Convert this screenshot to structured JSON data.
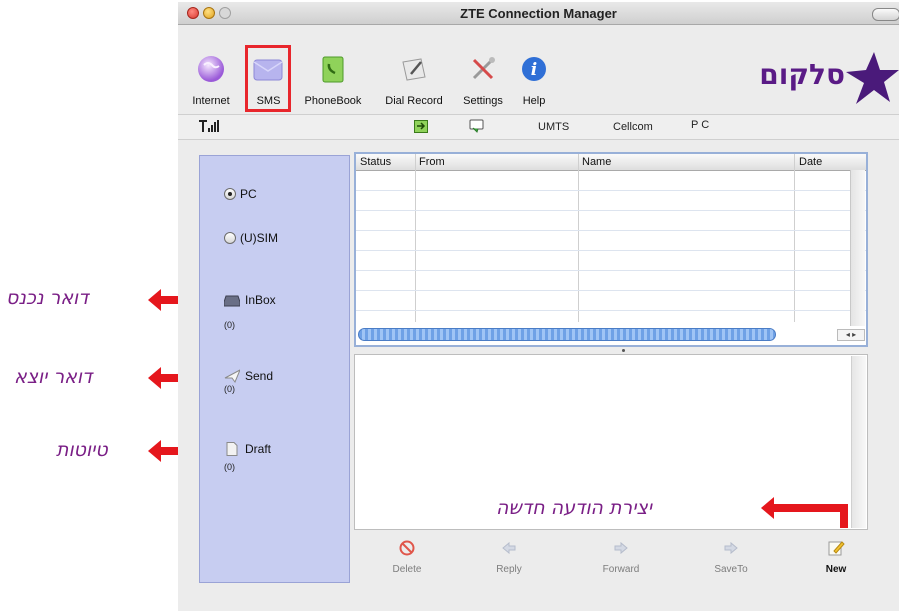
{
  "window": {
    "title": "ZTE Connection Manager"
  },
  "toolbar": {
    "items": [
      {
        "label": "Internet",
        "icon": "globe-icon"
      },
      {
        "label": "SMS",
        "icon": "envelope-icon",
        "highlighted": true
      },
      {
        "label": "PhoneBook",
        "icon": "phonebook-icon"
      },
      {
        "label": "Dial Record",
        "icon": "dial-record-icon"
      },
      {
        "label": "Settings",
        "icon": "settings-tools-icon"
      },
      {
        "label": "Help",
        "icon": "help-icon"
      }
    ],
    "logo_text": "סלקום",
    "colors": {
      "highlight": "#e8262c",
      "logo": "#5a1b86"
    }
  },
  "status": {
    "network_type": "UMTS",
    "operator": "Cellcom",
    "location": "P C"
  },
  "storage": {
    "options": [
      {
        "label": "PC",
        "selected": true
      },
      {
        "label": "(U)SIM",
        "selected": false
      }
    ]
  },
  "folders": [
    {
      "label": "InBox",
      "count": "(0)",
      "icon": "inbox-tray-icon"
    },
    {
      "label": "Send",
      "count": "(0)",
      "icon": "paper-plane-icon"
    },
    {
      "label": "Draft",
      "count": "(0)",
      "icon": "document-icon"
    }
  ],
  "table": {
    "columns": [
      "Status",
      "From",
      "Name",
      "Date"
    ],
    "rows": []
  },
  "actions": [
    {
      "label": "Delete",
      "icon": "delete-icon",
      "enabled": true
    },
    {
      "label": "Reply",
      "icon": "reply-icon",
      "enabled": false
    },
    {
      "label": "Forward",
      "icon": "forward-icon",
      "enabled": false
    },
    {
      "label": "SaveTo",
      "icon": "save-to-icon",
      "enabled": false
    },
    {
      "label": "New",
      "icon": "new-message-icon",
      "enabled": true
    }
  ],
  "annotations": {
    "inbox": "דואר נכנס",
    "send": "דואר יוצא",
    "draft": "טיוטות",
    "new": "יצירת הודעה חדשה",
    "color": "#7a1f86",
    "arrow_color": "#e5171d"
  }
}
